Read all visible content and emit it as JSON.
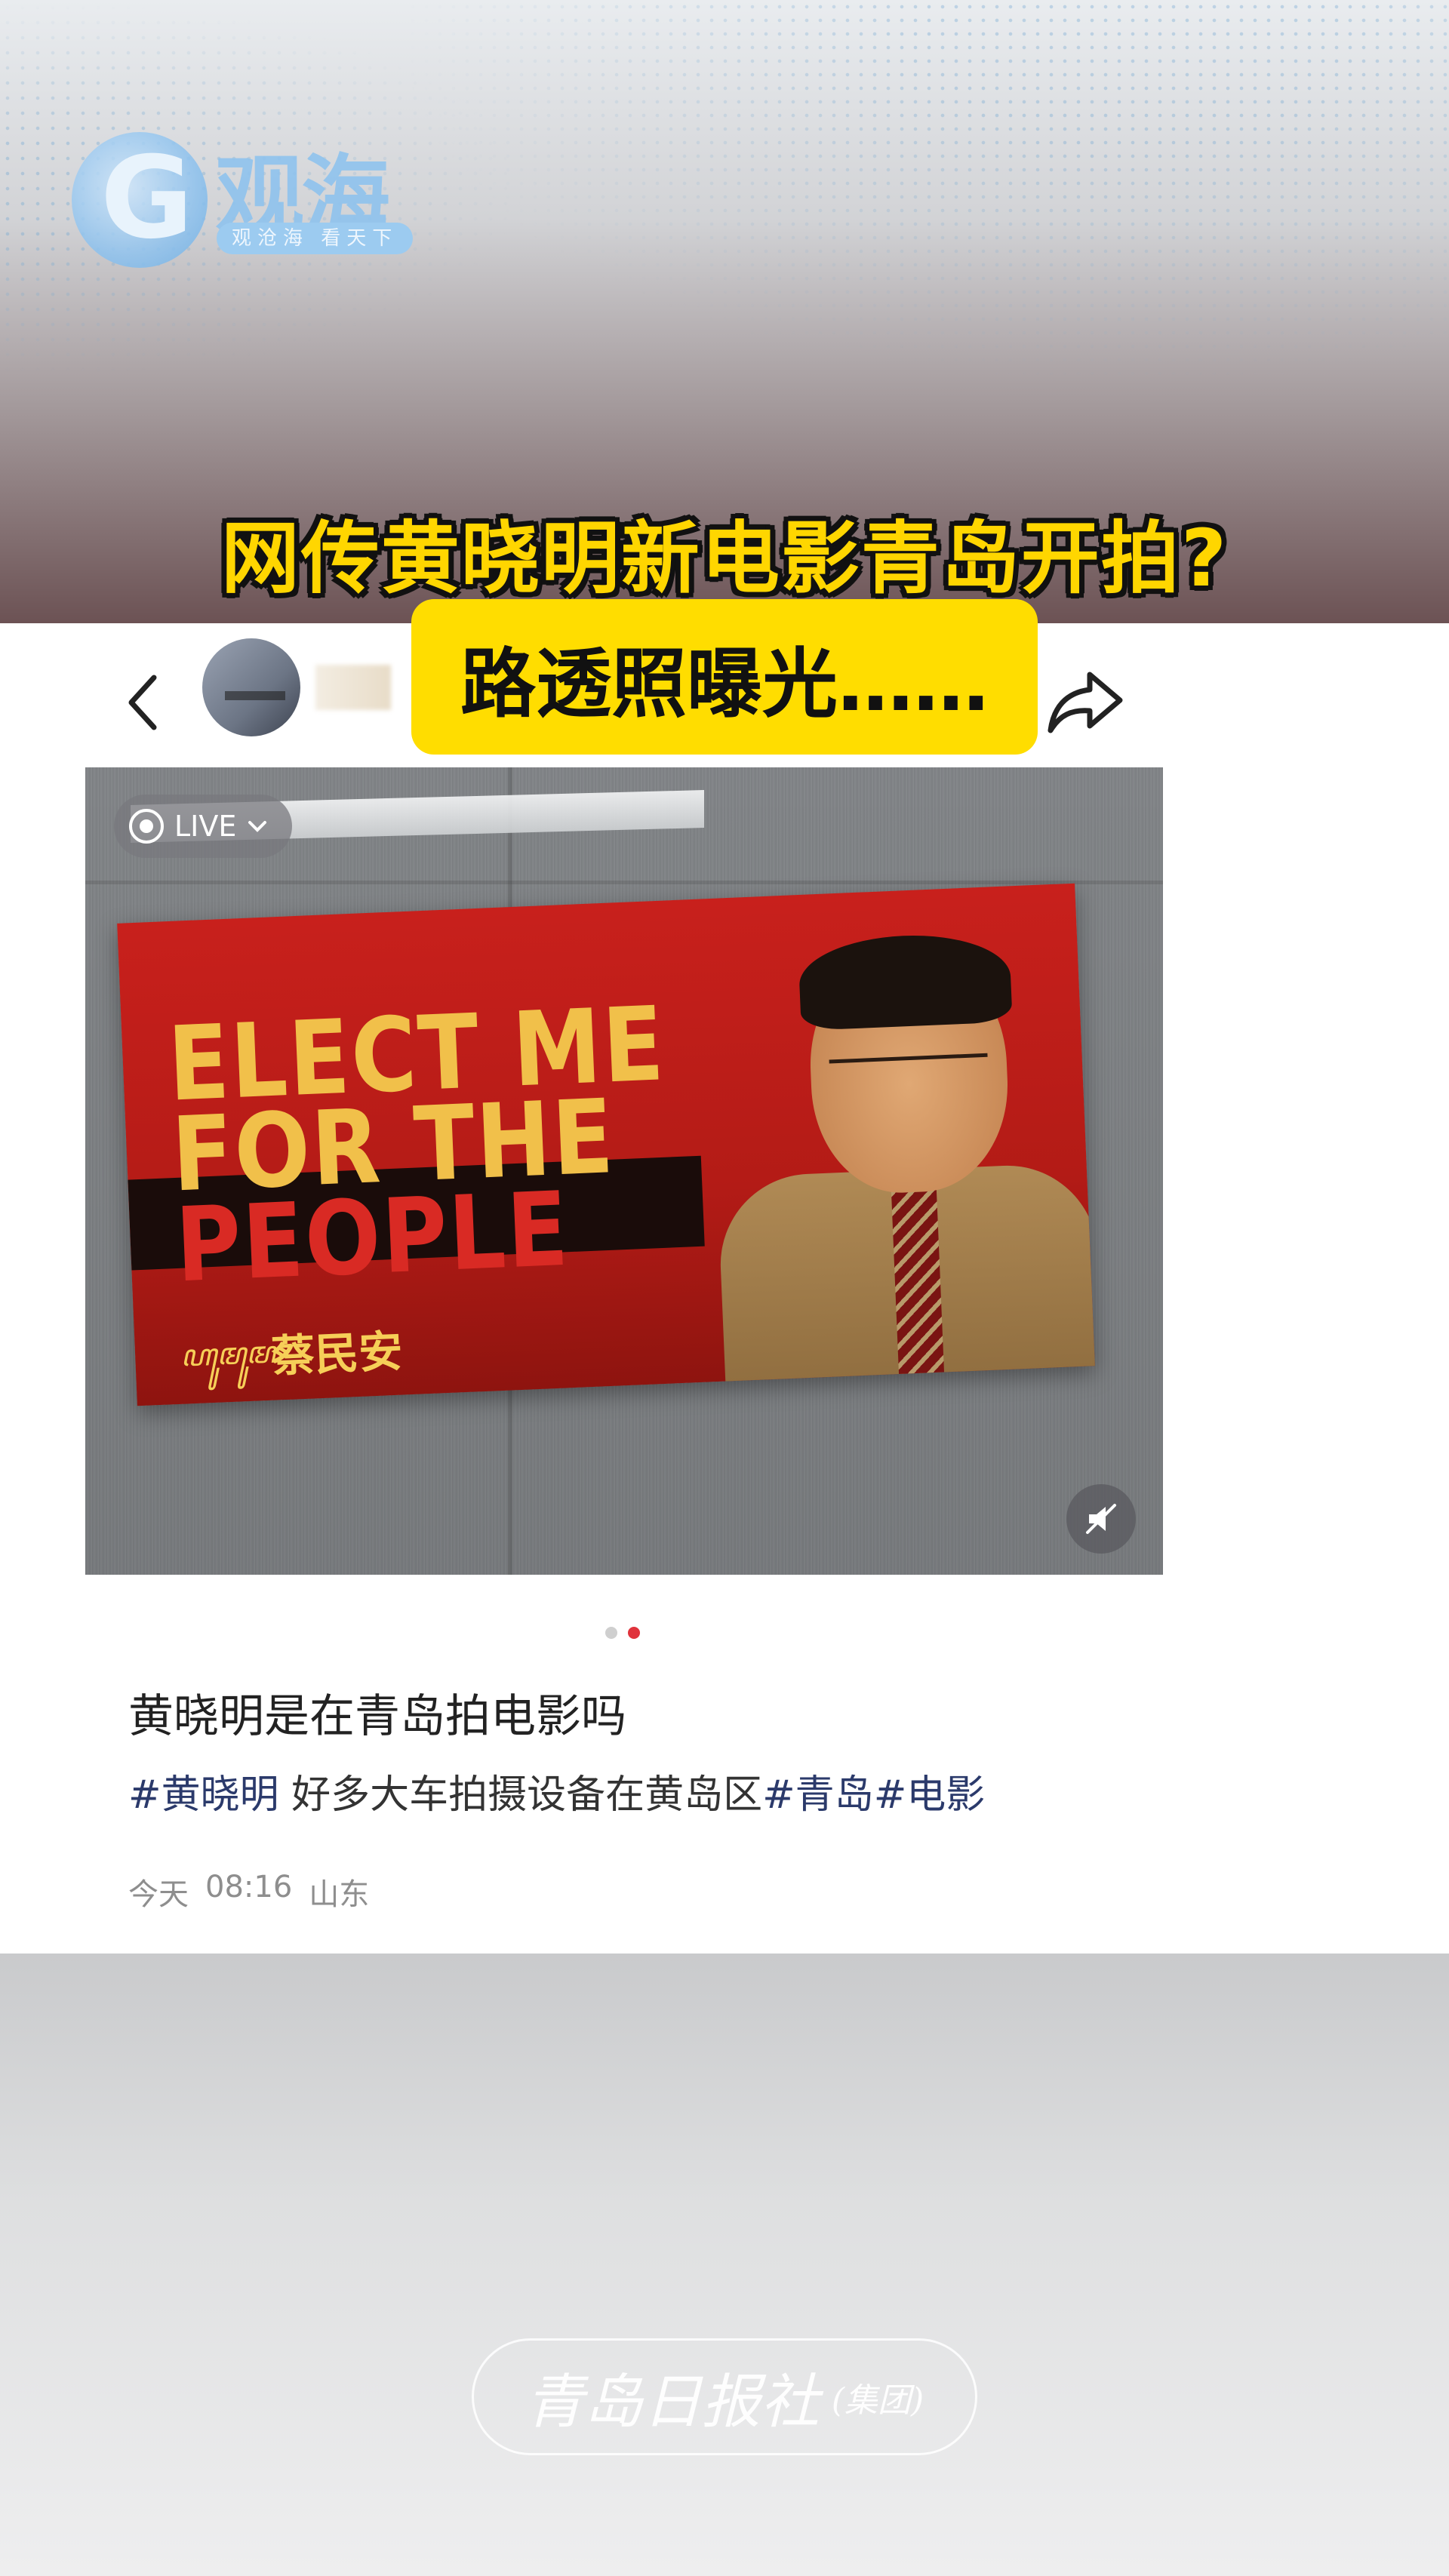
{
  "header": {
    "logo": {
      "glyph": "G",
      "name": "观海",
      "slogan": "观沧海 看天下"
    },
    "headline": "网传黄晓明新电影青岛开拍?"
  },
  "post": {
    "subheadline": "路透照曝光……",
    "photo": {
      "live_label": "LIVE",
      "billboard": {
        "line1": "ELECT ME",
        "line2": "FOR THE",
        "line3": "PEOPLE",
        "script_text": "ꦲꦸꦩꦸꦩ",
        "name": "蔡民安"
      }
    },
    "pager": {
      "total": 2,
      "active_index": 1
    },
    "title": "黄晓明是在青岛拍电影吗",
    "body": {
      "tag1": "#黄晓明",
      "text": " 好多大车拍摄设备在黄岛区",
      "tag2": "#青岛",
      "tag3": "#电影"
    },
    "meta": {
      "date": "今天",
      "time": "08:16",
      "location": "山东"
    }
  },
  "footer": {
    "press_name": "青岛日报社",
    "press_group": "(集团)"
  },
  "colors": {
    "headline_yellow": "#ffd600",
    "subhead_bg": "#ffdd00",
    "tag_blue": "#2b3a6b",
    "pager_active": "#e0333c"
  },
  "icons": [
    "back-icon",
    "share-icon",
    "live-icon",
    "chevron-down-icon",
    "mute-icon"
  ]
}
